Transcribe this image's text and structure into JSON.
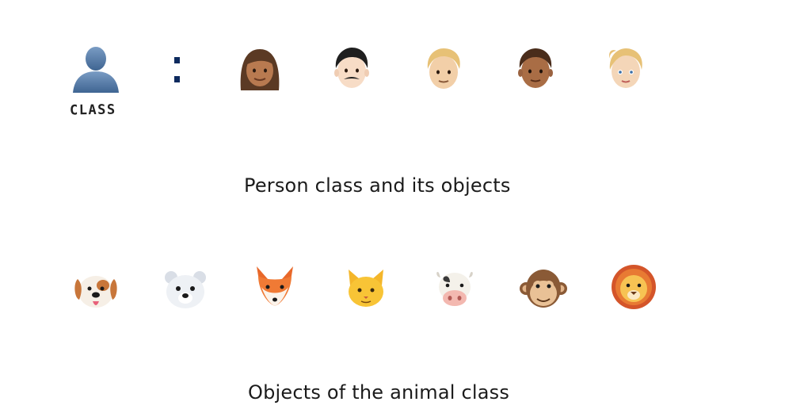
{
  "person_section": {
    "class_label": "CLASS",
    "caption": "Person class and its objects",
    "class_icon": "person-silhouette-icon",
    "objects": [
      "woman-medium-skin",
      "man-mustache",
      "person-blond-hair",
      "man-medium-dark-skin",
      "woman-blond-ponytail"
    ]
  },
  "animal_section": {
    "caption": "Objects of the animal class",
    "objects": [
      "dog-face",
      "polar-bear-face",
      "fox-face",
      "cat-face",
      "cow-face",
      "monkey-face",
      "lion-face"
    ]
  },
  "colors": {
    "caption_text": "#1b1b1b",
    "silhouette": "#4f77a6",
    "colon": "#0d2a5e"
  }
}
